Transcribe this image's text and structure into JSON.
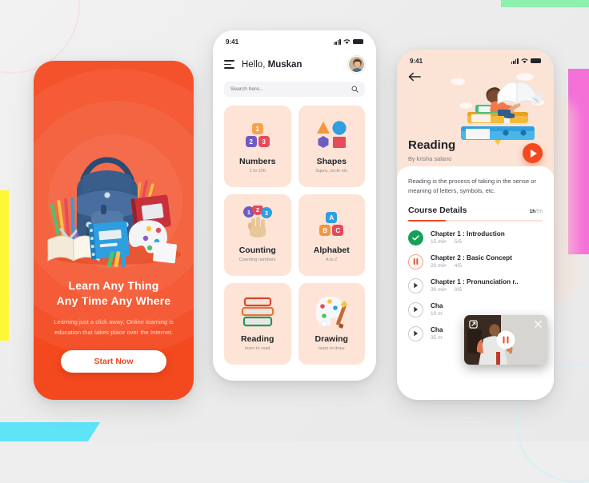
{
  "onboarding": {
    "title_line1": "Learn Any Thing",
    "title_line2": "Any Time Any Where",
    "subtitle": "Learning just a click away; Online learning is education that takes place over the Internet.",
    "cta_label": "Start Now",
    "bg_color": "#f4481f",
    "illustration": "school-supplies-backpack-books"
  },
  "home": {
    "status": {
      "time": "9:41",
      "signal": "signal-icon",
      "wifi": "wifi-icon",
      "battery": "battery-icon"
    },
    "menu_icon": "hamburger-menu-icon",
    "greeting_prefix": "Hello, ",
    "greeting_name": "Muskan",
    "avatar": "user-avatar",
    "search": {
      "placeholder": "Search here...",
      "icon": "search-icon",
      "value": ""
    },
    "categories": [
      {
        "title": "Numbers",
        "subtitle": "1 to 100",
        "art": "number-blocks",
        "blocks": [
          {
            "n": "1",
            "color": "#f7a34b"
          },
          {
            "n": "2",
            "color": "#6f5bc4"
          },
          {
            "n": "3",
            "color": "#e54b5a"
          }
        ]
      },
      {
        "title": "Shapes",
        "subtitle": "Squre, circle etc",
        "art": "geometric-shapes",
        "colors": [
          "#f2963f",
          "#2f9fe0",
          "#6f5bc4",
          "#e54b5a"
        ]
      },
      {
        "title": "Counting",
        "subtitle": "Counting numbers",
        "art": "hand-counting",
        "bubbles": [
          {
            "n": "1",
            "color": "#6f5bc4"
          },
          {
            "n": "2",
            "color": "#e54b5a"
          },
          {
            "n": "3",
            "color": "#2f9fe0"
          }
        ]
      },
      {
        "title": "Alphabet",
        "subtitle": "A to Z",
        "art": "letter-blocks",
        "blocks": [
          {
            "n": "A",
            "color": "#2f9fe0"
          },
          {
            "n": "B",
            "color": "#f2963f"
          },
          {
            "n": "C",
            "color": "#e54b5a"
          }
        ]
      },
      {
        "title": "Reading",
        "subtitle": "learn to read",
        "art": "stacked-books"
      },
      {
        "title": "Drawing",
        "subtitle": "learn to draw",
        "art": "paint-palette-brush"
      }
    ]
  },
  "detail": {
    "status": {
      "time": "9:41",
      "signal": "signal-icon",
      "wifi": "wifi-icon",
      "battery": "battery-icon"
    },
    "back_icon": "back-arrow-icon",
    "hero_illustration": "child-reading-on-books",
    "title": "Reading",
    "author": "By krisha salano",
    "play_icon": "play-icon",
    "description": "Reading is the process of taking in the sense or meaning of letters, symbols, etc.",
    "course_details_label": "Course Details",
    "progress_done": "1h",
    "progress_total": "/5h",
    "chapters": [
      {
        "name": "Chapter 1 : Introduction",
        "duration": "15 min",
        "lessons": "5/5",
        "state": "done",
        "icon": "check-icon"
      },
      {
        "name": "Chapter 2 : Basic Concept",
        "duration": "20 min",
        "lessons": "4/5",
        "state": "playing",
        "icon": "pause-icon"
      },
      {
        "name": "Chapter 1 : Pronunciation r..",
        "duration": "30 min",
        "lessons": "0/5",
        "state": "locked",
        "icon": "play-icon"
      },
      {
        "name": "Cha",
        "duration": "10 m",
        "lessons": "",
        "state": "locked",
        "icon": "play-icon"
      },
      {
        "name": "Cha",
        "duration": "35 m",
        "lessons": "",
        "state": "locked",
        "icon": "play-icon"
      }
    ],
    "pip": {
      "expand_icon": "picture-in-picture-expand-icon",
      "close_icon": "close-icon",
      "pause_icon": "pause-icon",
      "content": "video-person-writing-on-whiteboard"
    }
  },
  "decor": {
    "green": "#8ef0ae",
    "pink": "#f472d8",
    "yellow": "#fdf736",
    "cyan": "#5fe3f7",
    "accent": "#f4481f",
    "card_bg": "#fde4d6"
  }
}
